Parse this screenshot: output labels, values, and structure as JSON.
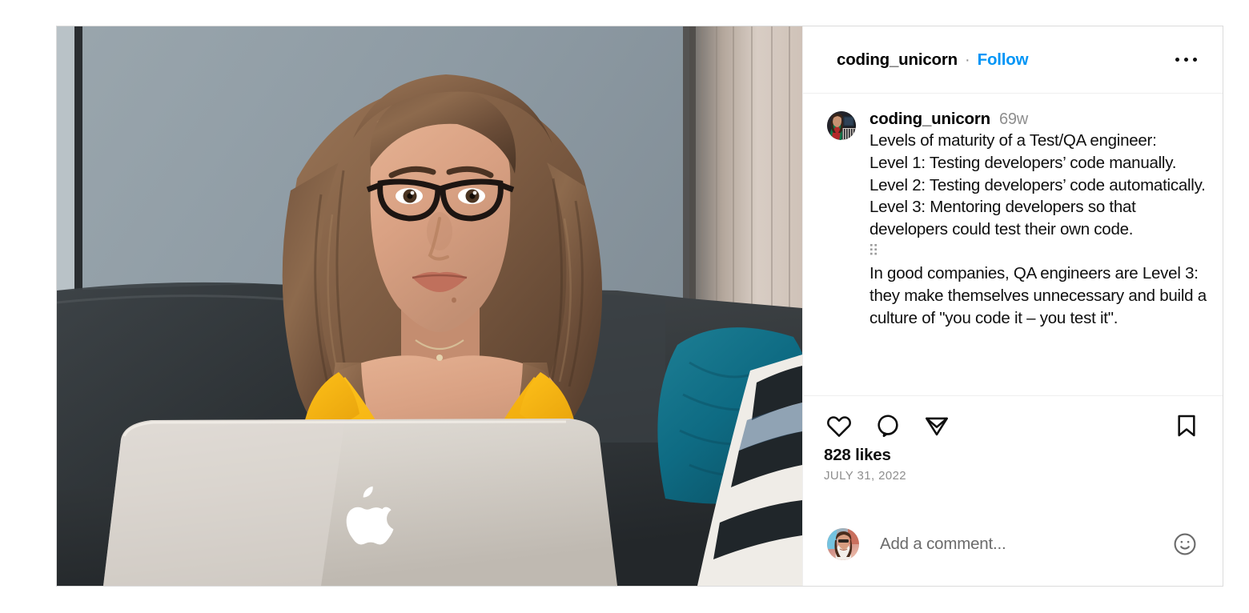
{
  "post": {
    "header": {
      "username": "coding_unicorn",
      "separator": "·",
      "follow_label": "Follow",
      "more_options_icon": "more-horizontal-icon"
    },
    "caption": {
      "username": "coding_unicorn",
      "age": "69w",
      "text": "Levels of maturity of a Test/QA engineer:\nLevel 1: Testing developers’ code manually.\nLevel 2: Testing developers’ code automatically.\nLevel 3: Mentoring developers so that developers could test their own code.",
      "separator_glyph": "dot-grid-glyph",
      "text_part_two": "In good companies, QA engineers are Level 3: they make themselves unnecessary and build a culture of \"you code it – you test it\"."
    },
    "actions": {
      "like_icon": "heart-icon",
      "comment_icon": "speech-bubble-icon",
      "share_icon": "paper-plane-icon",
      "save_icon": "bookmark-icon"
    },
    "likes": "828 likes",
    "date": "JULY 31, 2022",
    "composer": {
      "placeholder": "Add a comment...",
      "emoji_icon": "smiley-face-icon"
    },
    "media": {
      "alt": "Woman in yellow dress with glasses sitting on dark sofa using a silver MacBook laptop",
      "laptop_logo": "apple-logo"
    }
  },
  "colors": {
    "link_blue": "#0095f6",
    "text_primary": "#0f0f0f",
    "text_secondary": "#8e8e8e",
    "border": "#efefef",
    "card_border": "#dbdbdb",
    "background": "#ffffff"
  }
}
